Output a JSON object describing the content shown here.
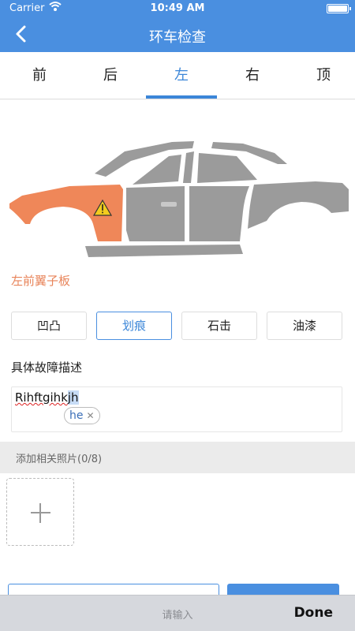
{
  "status_bar": {
    "carrier": "Carrier",
    "time": "10:49 AM"
  },
  "nav": {
    "title": "环车检查"
  },
  "tabs": [
    {
      "label": "前"
    },
    {
      "label": "后"
    },
    {
      "label": "左",
      "active": true
    },
    {
      "label": "右"
    },
    {
      "label": "顶"
    }
  ],
  "car": {
    "selected_part": "左前翼子板",
    "highlight_color": "#ef8759",
    "body_color": "#9b9b9b"
  },
  "damage_types": [
    {
      "label": "凹凸"
    },
    {
      "label": "划痕",
      "active": true
    },
    {
      "label": "石击"
    },
    {
      "label": "油漆"
    }
  ],
  "description": {
    "label": "具体故障描述",
    "typed_text": "Rihftgihk",
    "marked_text": "jh",
    "autocorrect_suggestion": "he"
  },
  "photos": {
    "header": "添加相关照片(0/8)"
  },
  "keyboard_bar": {
    "placeholder": "请输入",
    "done_label": "Done"
  },
  "colors": {
    "accent": "#4a8fe0",
    "highlight": "#e8845a"
  }
}
